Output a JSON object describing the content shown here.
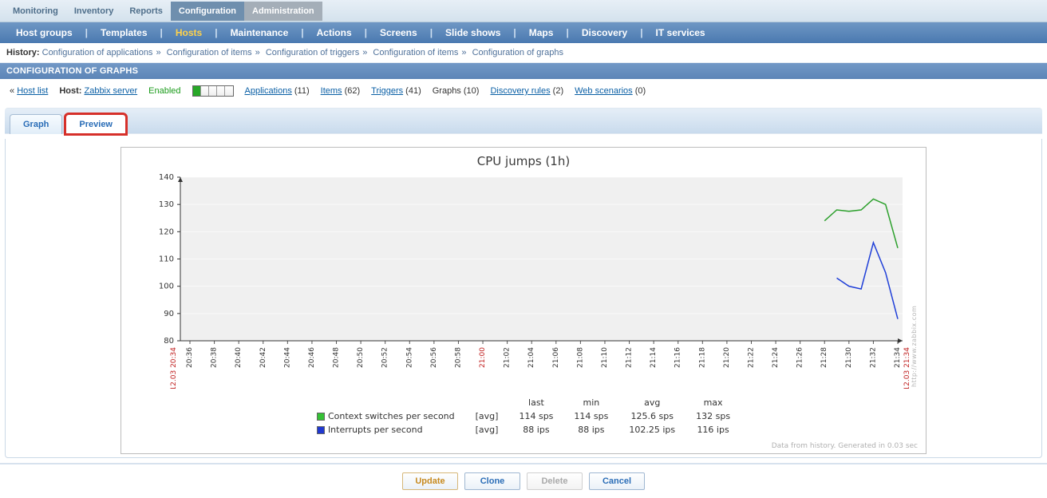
{
  "nav": {
    "primary": [
      {
        "label": "Monitoring",
        "state": ""
      },
      {
        "label": "Inventory",
        "state": ""
      },
      {
        "label": "Reports",
        "state": ""
      },
      {
        "label": "Configuration",
        "state": "active"
      },
      {
        "label": "Administration",
        "state": "disabled"
      }
    ],
    "sub": [
      {
        "label": "Host groups"
      },
      {
        "label": "Templates"
      },
      {
        "label": "Hosts",
        "active": true
      },
      {
        "label": "Maintenance"
      },
      {
        "label": "Actions"
      },
      {
        "label": "Screens"
      },
      {
        "label": "Slide shows"
      },
      {
        "label": "Maps"
      },
      {
        "label": "Discovery"
      },
      {
        "label": "IT services"
      }
    ]
  },
  "breadcrumb": {
    "label": "History:",
    "items": [
      "Configuration of applications",
      "Configuration of items",
      "Configuration of triggers",
      "Configuration of items",
      "Configuration of graphs"
    ]
  },
  "section_title": "CONFIGURATION OF GRAPHS",
  "host": {
    "back": "« ",
    "back_link": "Host list",
    "host_label": "Host:",
    "host_name": "Zabbix server",
    "status": "Enabled",
    "links": [
      {
        "name": "Applications",
        "count": "(11)",
        "link": true
      },
      {
        "name": "Items",
        "count": "(62)",
        "link": true
      },
      {
        "name": "Triggers",
        "count": "(41)",
        "link": true
      },
      {
        "name": "Graphs",
        "count": "(10)",
        "link": false
      },
      {
        "name": "Discovery rules",
        "count": "(2)",
        "link": true
      },
      {
        "name": "Web scenarios",
        "count": "(0)",
        "link": true
      }
    ]
  },
  "tabs": {
    "graph": "Graph",
    "preview": "Preview"
  },
  "footer": {
    "update": "Update",
    "clone": "Clone",
    "delete": "Delete",
    "cancel": "Cancel"
  },
  "side_credit": "http://www.zabbix.com",
  "legend_note": "Data from history. Generated in 0.03 sec",
  "chart_data": {
    "type": "line",
    "title": "CPU jumps (1h)",
    "ylabel": "",
    "ylim": [
      80,
      140
    ],
    "yticks": [
      80,
      90,
      100,
      110,
      120,
      130,
      140
    ],
    "x_ticks": [
      "20:36",
      "20:38",
      "20:40",
      "20:42",
      "20:44",
      "20:46",
      "20:48",
      "20:50",
      "20:52",
      "20:54",
      "20:56",
      "20:58",
      "21:00",
      "21:02",
      "21:04",
      "21:06",
      "21:08",
      "21:10",
      "21:12",
      "21:14",
      "21:16",
      "21:18",
      "21:20",
      "21:22",
      "21:24",
      "21:26",
      "21:28",
      "21:30",
      "21:32",
      "21:34"
    ],
    "x_hour_tick": "21:00",
    "x_start_label": "12.03 20:34",
    "x_end_label": "12.03 21:34",
    "series": [
      {
        "name": "Context switches per second",
        "color": "#2ca02c",
        "swatch": "#35c135",
        "mode": "avg",
        "unit": "sps",
        "stats": {
          "last": 114,
          "min": 114,
          "avg": 125.6,
          "max": 132
        },
        "points": [
          {
            "x": "21:28",
            "y": 124
          },
          {
            "x": "21:29",
            "y": 128
          },
          {
            "x": "21:30",
            "y": 127.5
          },
          {
            "x": "21:31",
            "y": 128
          },
          {
            "x": "21:32",
            "y": 132
          },
          {
            "x": "21:33",
            "y": 130
          },
          {
            "x": "21:34",
            "y": 114
          }
        ]
      },
      {
        "name": "Interrupts per second",
        "color": "#1f3fd8",
        "swatch": "#2038d0",
        "mode": "avg",
        "unit": "ips",
        "stats": {
          "last": 88,
          "min": 88,
          "avg": 102.25,
          "max": 116
        },
        "points": [
          {
            "x": "21:29",
            "y": 103
          },
          {
            "x": "21:30",
            "y": 100
          },
          {
            "x": "21:31",
            "y": 99
          },
          {
            "x": "21:32",
            "y": 116
          },
          {
            "x": "21:33",
            "y": 105
          },
          {
            "x": "21:34",
            "y": 88
          }
        ]
      }
    ],
    "legend_cols": [
      "last",
      "min",
      "avg",
      "max"
    ]
  }
}
